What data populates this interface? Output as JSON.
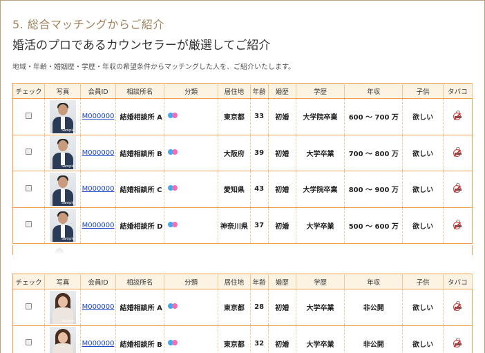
{
  "section": {
    "number_title": "5. 総合マッチングからご紹介",
    "heading": "婚活のプロであるカウンセラーが厳選してご紹介",
    "description": "地域・年齢・婚姻歴・学歴・年収の希望条件からマッチングした人を、ご紹介いたします。"
  },
  "columns": [
    "チェック",
    "写真",
    "会員ID",
    "相談所名",
    "分類",
    "居住地",
    "年齢",
    "婚歴",
    "学歴",
    "年収",
    "子供",
    "タバコ"
  ],
  "colors": {
    "accent_border": "#f0a04b",
    "header_bg": "#fdf3e3",
    "dot_blue": "#3fa9f5",
    "dot_pink": "#f06eb4",
    "link": "#1a44c8",
    "no_smoking": "#d23a3a"
  },
  "photo_watermark": "Sample",
  "tables": [
    {
      "rows": [
        {
          "member_id": "M000000",
          "agency": "結婚相談所 A",
          "residence": "東京都",
          "age": "33",
          "marital": "初婚",
          "education": "大学院卒業",
          "income": "600 ～ 700 万",
          "children": "欲しい",
          "tobacco_icon": "no-smoking-icon"
        },
        {
          "member_id": "M000000",
          "agency": "結婚相談所 B",
          "residence": "大阪府",
          "age": "39",
          "marital": "初婚",
          "education": "大学卒業",
          "income": "700 ～ 800 万",
          "children": "欲しい",
          "tobacco_icon": "no-smoking-icon"
        },
        {
          "member_id": "M000000",
          "agency": "結婚相談所 C",
          "residence": "愛知県",
          "age": "43",
          "marital": "初婚",
          "education": "大学院卒業",
          "income": "800 ～ 900 万",
          "children": "欲しい",
          "tobacco_icon": "no-smoking-icon"
        },
        {
          "member_id": "M000000",
          "agency": "結婚相談所 D",
          "residence": "神奈川県",
          "age": "37",
          "marital": "初婚",
          "education": "大学卒業",
          "income": "500 ～ 600 万",
          "children": "欲しい",
          "tobacco_icon": "no-smoking-icon"
        }
      ]
    },
    {
      "rows": [
        {
          "member_id": "M000000",
          "agency": "結婚相談所 A",
          "residence": "東京都",
          "age": "28",
          "marital": "初婚",
          "education": "大学卒業",
          "income": "非公開",
          "children": "欲しい",
          "tobacco_icon": "no-smoking-icon"
        },
        {
          "member_id": "M000000",
          "agency": "結婚相談所 B",
          "residence": "東京都",
          "age": "32",
          "marital": "初婚",
          "education": "大学卒業",
          "income": "非公開",
          "children": "欲しい",
          "tobacco_icon": "no-smoking-icon"
        }
      ]
    }
  ]
}
